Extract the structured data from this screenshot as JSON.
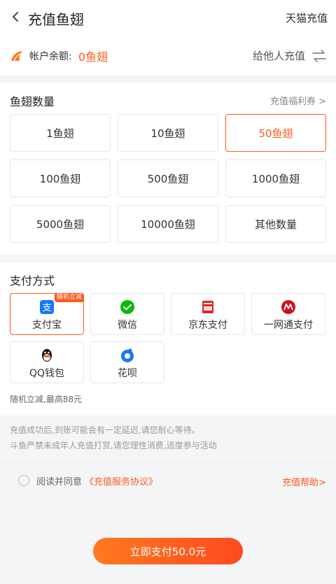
{
  "header": {
    "title": "充值鱼翅",
    "tmall_label": "天猫充值"
  },
  "account": {
    "label": "帐户余额:",
    "value": "0鱼翅",
    "gift_label": "给他人充值"
  },
  "fins": {
    "title": "鱼翅数量",
    "welfare_label": "充值福利券 >",
    "options": [
      {
        "label": "1鱼翅",
        "selected": false
      },
      {
        "label": "10鱼翅",
        "selected": false
      },
      {
        "label": "50鱼翅",
        "selected": true
      },
      {
        "label": "100鱼翅",
        "selected": false
      },
      {
        "label": "500鱼翅",
        "selected": false
      },
      {
        "label": "1000鱼翅",
        "selected": false
      },
      {
        "label": "5000鱼翅",
        "selected": false
      },
      {
        "label": "10000鱼翅",
        "selected": false
      },
      {
        "label": "其他数量",
        "selected": false
      }
    ]
  },
  "payment": {
    "title": "支付方式",
    "methods": [
      {
        "label": "支付宝",
        "icon": "alipay-icon",
        "badge": "随机立减",
        "selected": true,
        "color": "#1677ff"
      },
      {
        "label": "微信",
        "icon": "wechat-icon",
        "badge": "",
        "selected": false,
        "color": "#09bb07"
      },
      {
        "label": "京东支付",
        "icon": "jdpay-icon",
        "badge": "",
        "selected": false,
        "color": "#e1251b"
      },
      {
        "label": "一网通支付",
        "icon": "cmb-icon",
        "badge": "",
        "selected": false,
        "color": "#c8161d"
      },
      {
        "label": "QQ钱包",
        "icon": "qq-icon",
        "badge": "",
        "selected": false,
        "color": "#111111"
      },
      {
        "label": "花呗",
        "icon": "huabei-icon",
        "badge": "",
        "selected": false,
        "color": "#1677ff"
      }
    ],
    "random_note": "随机立减,最高88元"
  },
  "notes": {
    "line1": "充值成功后,到账可能会有一定延迟,请您耐心等待。",
    "line2": "斗鱼严禁未成年人充值打赏,请您理性消费,适度参与活动"
  },
  "agreement": {
    "text": "阅读并同意",
    "link": "《充值服务协议》",
    "help": "充值帮助>"
  },
  "pay_button": {
    "label": "立即支付50.0元"
  },
  "colors": {
    "accent": "#ff5a1f"
  }
}
